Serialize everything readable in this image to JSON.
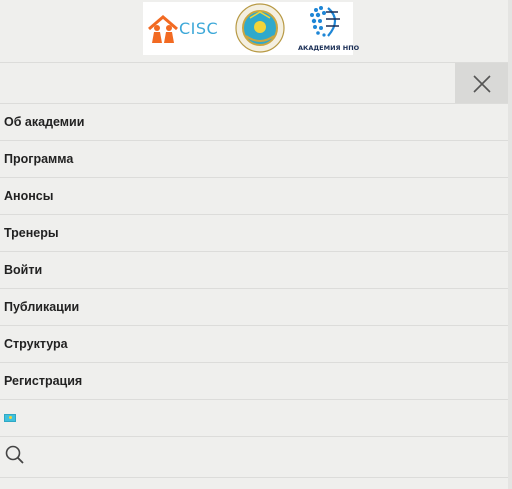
{
  "logos": {
    "cisc_text": "CISC",
    "academy_text": "АКАДЕМИЯ НПО"
  },
  "menu": {
    "items": [
      {
        "label": "Об академии"
      },
      {
        "label": "Программа"
      },
      {
        "label": "Анонсы"
      },
      {
        "label": "Тренеры"
      },
      {
        "label": "Войти"
      },
      {
        "label": "Публикации"
      },
      {
        "label": "Структура"
      },
      {
        "label": "Регистрация"
      }
    ]
  },
  "icons": {
    "close": "close-icon",
    "flag": "kazakhstan-flag-icon",
    "search": "search-icon"
  },
  "colors": {
    "background": "#efefed",
    "close_button_bg": "#d9d9d7",
    "text": "#222222"
  }
}
